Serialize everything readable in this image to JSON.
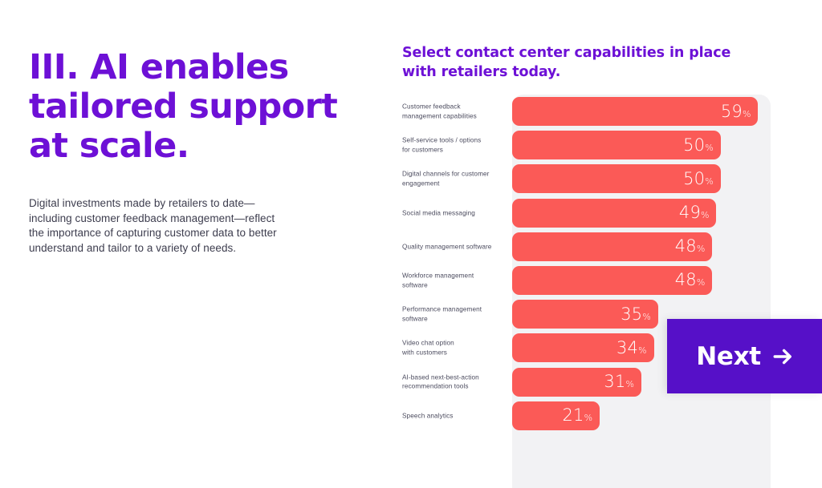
{
  "colors": {
    "purple": "#6d10d6",
    "button_purple": "#5610c8",
    "bar_coral": "#fb5a57",
    "panel_gray": "#f2f2f4",
    "label_text": "#4b4b5e"
  },
  "left": {
    "heading": "III. AI enables\ntailored support\nat scale.",
    "body": "Digital investments made by retailers to date—\nincluding customer feedback management—reflect\nthe importance of capturing customer data to better\nunderstand and tailor to a variety of needs."
  },
  "chart": {
    "title": "Select contact center capabilities in place\nwith retailers today.",
    "percent_suffix": "%"
  },
  "chart_data": {
    "type": "bar",
    "orientation": "horizontal",
    "title": "Select contact center capabilities in place with retailers today.",
    "xlabel": "",
    "ylabel": "",
    "xlim": [
      0,
      62
    ],
    "grid": false,
    "legend": false,
    "unit": "%",
    "categories": [
      "Customer feedback\nmanagement capabilities",
      "Self-service tools / options\nfor customers",
      "Digital channels for customer\nengagement",
      "Social media messaging",
      "Quality management software",
      "Workforce management\nsoftware",
      "Performance management\nsoftware",
      "Video chat option\nwith customers",
      "AI-based next-best-action\nrecommendation tools",
      "Speech analytics"
    ],
    "values": [
      59,
      50,
      50,
      49,
      48,
      48,
      35,
      34,
      31,
      21
    ]
  },
  "footer": {
    "next_label": "Next",
    "next_icon": "arrow-right-icon"
  }
}
